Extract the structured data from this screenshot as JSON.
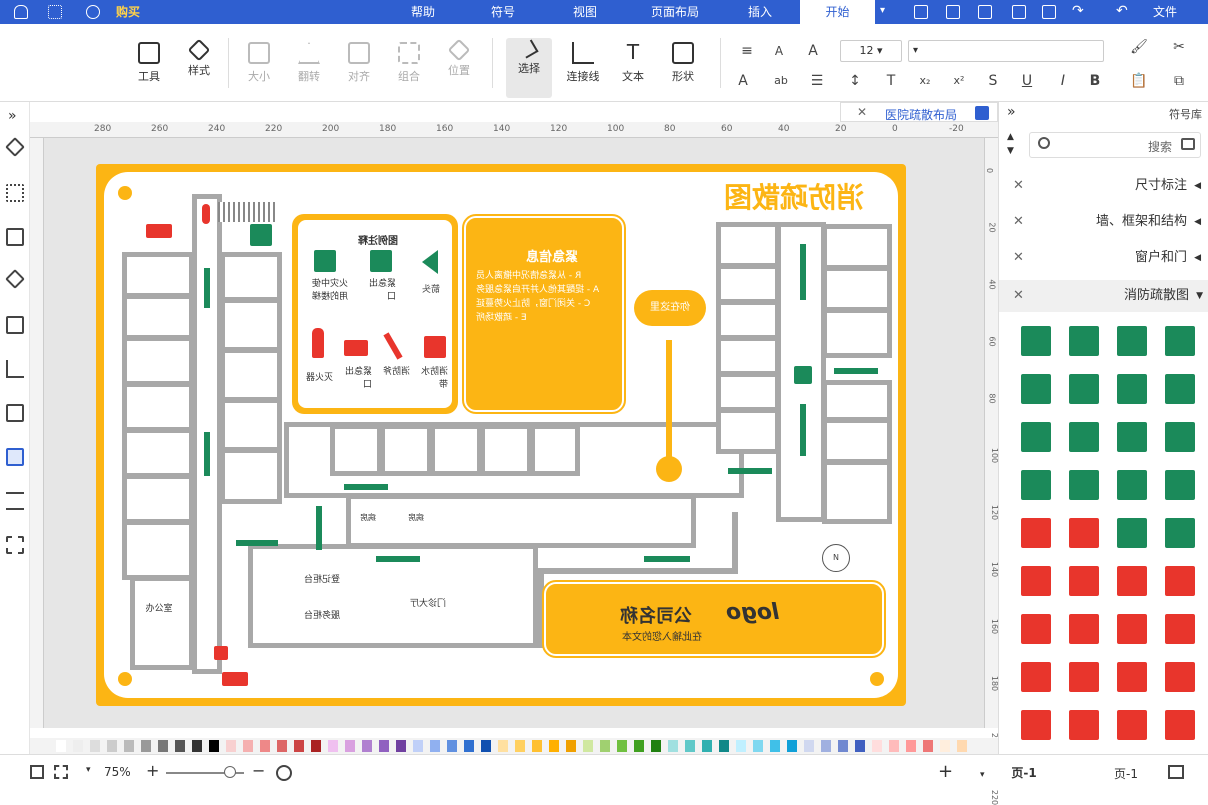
{
  "menu": {
    "file": "文件",
    "tabs": [
      "开始",
      "插入",
      "页面布局",
      "视图",
      "符号",
      "帮助"
    ],
    "buy": "购买"
  },
  "toolbar": {
    "tools": [
      "选择",
      "连接线",
      "文本",
      "形状",
      "工具",
      "样式",
      "大小",
      "翻转",
      "对齐",
      "组合",
      "位置"
    ],
    "font_size": "12"
  },
  "doc_tab": {
    "label": "医院疏散布局"
  },
  "ruler_top": [
    "280",
    "260",
    "240",
    "220",
    "200",
    "180",
    "160",
    "140",
    "120",
    "100",
    "80",
    "60",
    "40",
    "20",
    "0",
    "-20"
  ],
  "ruler_right": [
    "0",
    "20",
    "40",
    "60",
    "80",
    "100",
    "120",
    "140",
    "160",
    "180",
    "200",
    "220"
  ],
  "diagram": {
    "title": "消防疏散图",
    "emergency_title": "紧急信息",
    "emergency_lines": [
      "R - 从紧急情况中撤离人员",
      "A - 提醒其他人并开启紧急服务",
      "C - 关闭门窗，防止火势蔓延",
      "E - 疏散场所"
    ],
    "you_are_here": "你在这里",
    "legend_title": "图例注释",
    "legend_items": [
      "箭头",
      "紧急出口",
      "火灾中使用的楼梯",
      "消防水带",
      "消防斧",
      "紧急出口",
      "灭火器"
    ],
    "rooms": [
      "病房",
      "病房",
      "登记柜台",
      "服务柜台",
      "门诊大厅",
      "办公室"
    ],
    "company_name": "公司名称",
    "company_sub": "在此输入您的文本",
    "logo": "logo"
  },
  "sidebar": {
    "header": "符号库",
    "search_placeholder": "搜索",
    "categories": [
      "尺寸标注",
      "墙、框架和结构",
      "窗户和门",
      "消防疏散图"
    ]
  },
  "status": {
    "page_select": "页-1",
    "page_tab": "页-1",
    "zoom": "75%",
    "add": "+"
  },
  "colors": {
    "accent": "#2f5fd0",
    "frame": "#fcb514",
    "safe": "#1b8a5a",
    "fire": "#e8352c",
    "wall": "#a8a8a8"
  }
}
